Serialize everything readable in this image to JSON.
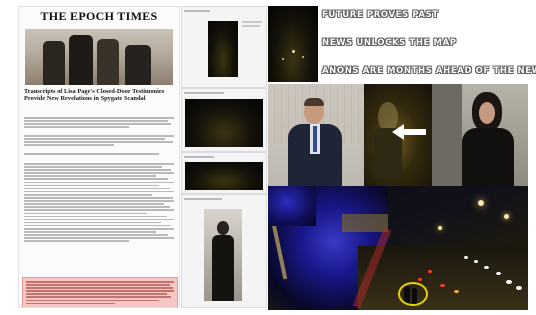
{
  "captions": {
    "line1": "FUTURE PROVES PAST",
    "line2": "NEWS UNLOCKS THE MAP",
    "line3": "ANONS ARE MONTHS AHEAD OF THE NEWS"
  },
  "article": {
    "masthead": "THE EPOCH TIMES",
    "headline": "Transcripts of Lisa Page's Closed-Door Testimonies Provide New Revelations in Spygate Scandal"
  },
  "colors": {
    "highlight": "#f6c7c4",
    "caption_text": "#ffffff",
    "circle_marker": "#e6d200",
    "arrow": "#ffffff"
  }
}
